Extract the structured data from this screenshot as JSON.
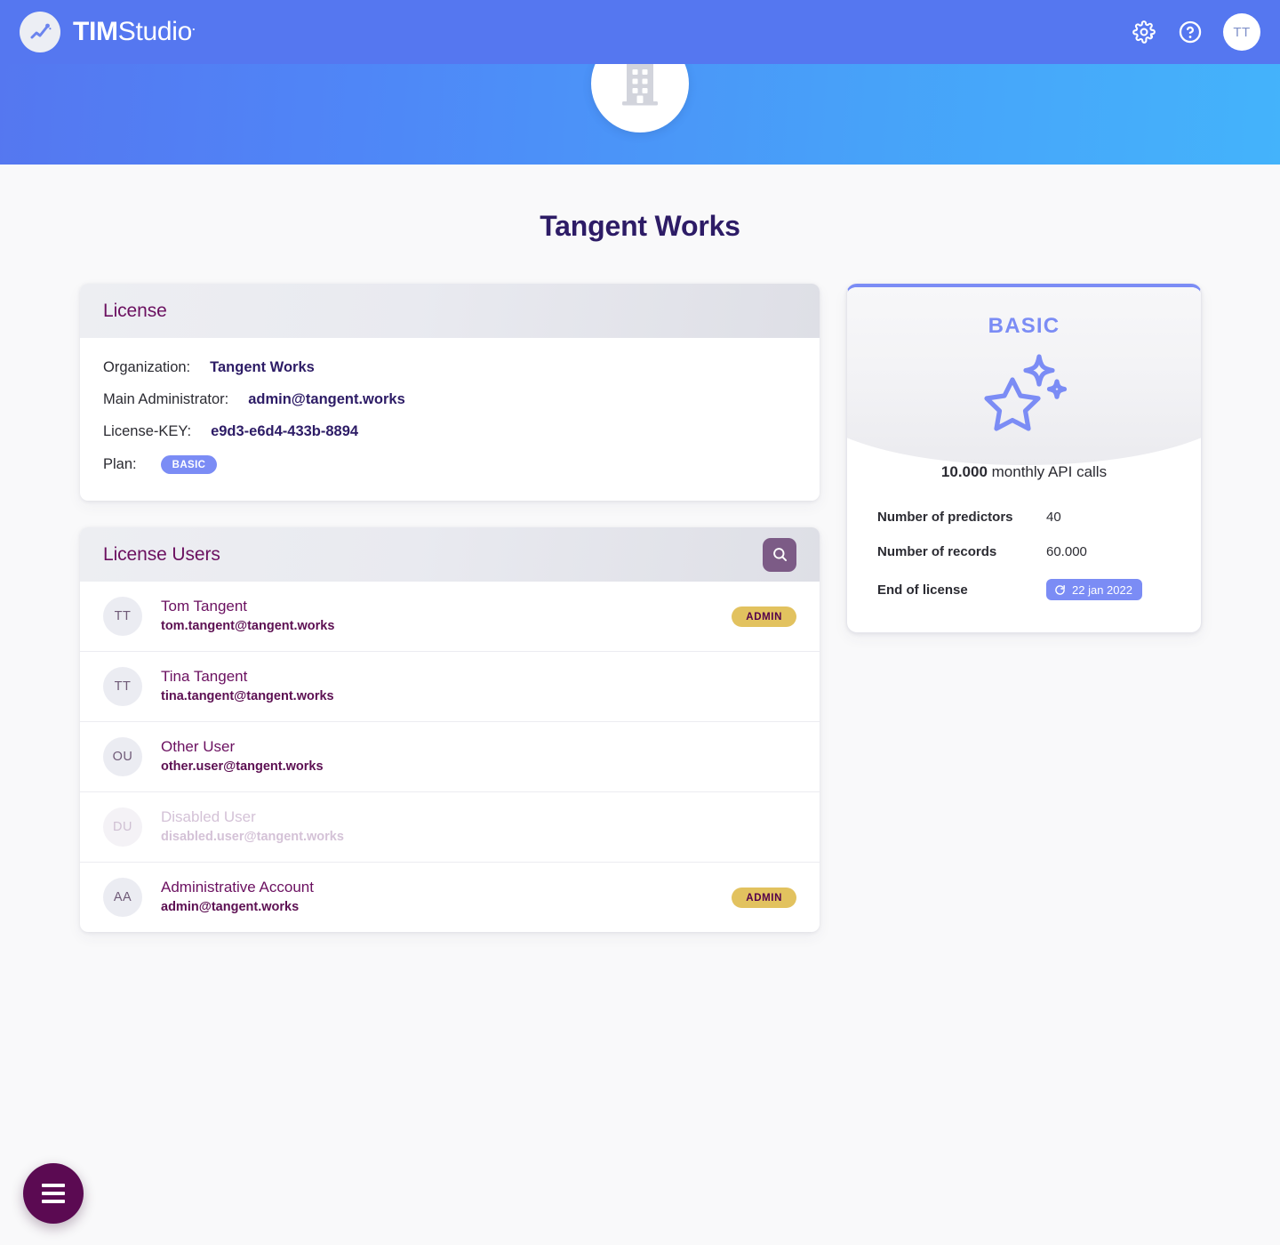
{
  "topnav": {
    "brand_bold": "TIM",
    "brand_light": "Studio",
    "brand_mark": ".",
    "logo_icon": "chart-trend-logo-icon",
    "settings_icon": "gear-icon",
    "help_icon": "question-circle-icon",
    "avatar_initials": "TT",
    "bar_color": "#5577f0"
  },
  "hero": {
    "org_icon": "building-icon",
    "org_title": "Tangent Works",
    "gradient_from": "#5577f0",
    "gradient_to": "#44b3fb"
  },
  "license_card": {
    "title": "License",
    "rows": [
      {
        "label": "Organization:",
        "value": "Tangent Works"
      },
      {
        "label": "Main Administrator:",
        "value": "admin@tangent.works"
      },
      {
        "label": "License-KEY:",
        "value": "e9d3-e6d4-433b-8894"
      }
    ],
    "plan_label": "Plan:",
    "plan_pill": "BASIC",
    "plan_pill_color": "#7b8cf5"
  },
  "users_card": {
    "title": "License Users",
    "search_icon": "search-icon",
    "search_button_color": "#7c5b86",
    "admin_badge_color": "#e2c25f",
    "users": [
      {
        "initials": "TT",
        "name": "Tom Tangent",
        "email": "tom.tangent@tangent.works",
        "badge": "ADMIN",
        "disabled": false
      },
      {
        "initials": "TT",
        "name": "Tina Tangent",
        "email": "tina.tangent@tangent.works",
        "badge": "",
        "disabled": false
      },
      {
        "initials": "OU",
        "name": "Other User",
        "email": "other.user@tangent.works",
        "badge": "",
        "disabled": false
      },
      {
        "initials": "DU",
        "name": "Disabled User",
        "email": "disabled.user@tangent.works",
        "badge": "",
        "disabled": true
      },
      {
        "initials": "AA",
        "name": "Administrative Account",
        "email": "admin@tangent.works",
        "badge": "ADMIN",
        "disabled": false
      }
    ]
  },
  "plan_card": {
    "title": "BASIC",
    "accent_color": "#7b8cf5",
    "star_icon": "sparkle-star-icon",
    "api_calls_value": "10.000",
    "api_calls_suffix": " monthly API calls",
    "specs": [
      {
        "key": "Number of predictors",
        "value": "40"
      },
      {
        "key": "Number of records",
        "value": "60.000"
      }
    ],
    "end_of_license_key": "End of license",
    "end_of_license_value": "22 jan 2022",
    "end_of_license_icon": "refresh-icon"
  },
  "fab": {
    "icon": "hamburger-menu-icon",
    "color": "#5b0a52"
  }
}
